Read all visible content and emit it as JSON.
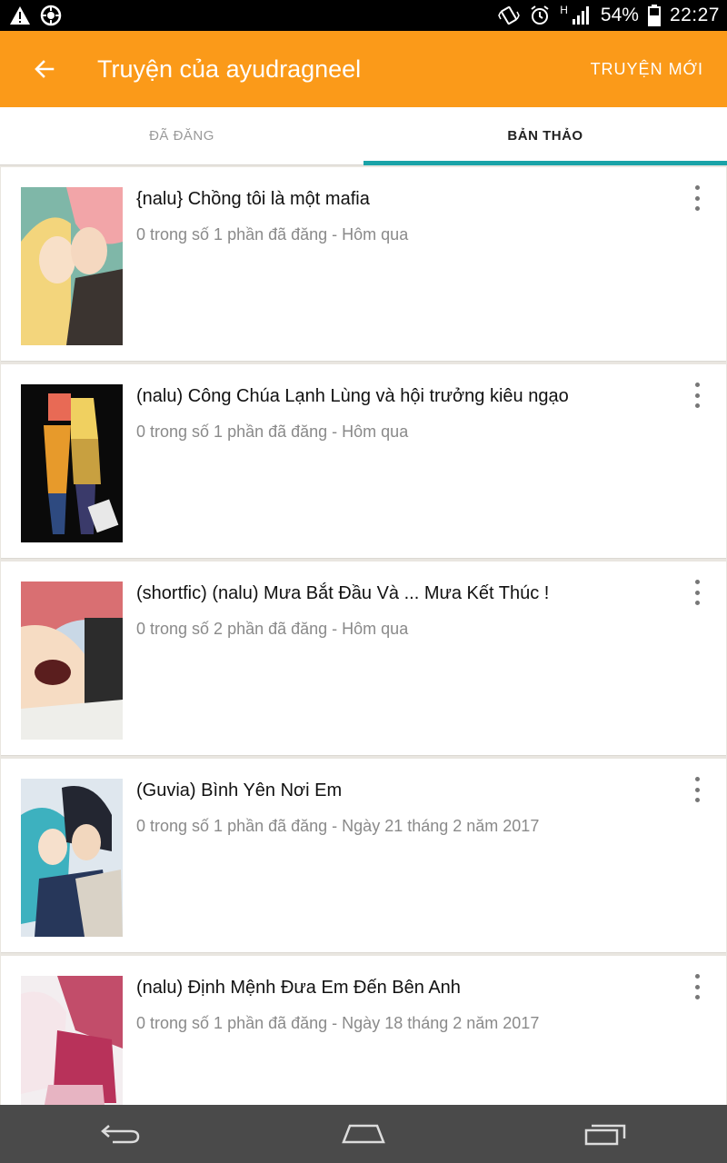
{
  "status_bar": {
    "left_icons": [
      "warning-icon",
      "sync-icon"
    ],
    "right_icons": [
      "vibrate-icon",
      "alarm-icon",
      "signal-icon",
      "battery-icon"
    ],
    "network_type": "H",
    "battery": "54%",
    "time": "22:27"
  },
  "app_bar": {
    "title": "Truyện của ayudragneel",
    "action": "TRUYỆN MỚI",
    "background": "#fb9a19"
  },
  "tabs": [
    {
      "label": "ĐÃ ĐĂNG",
      "active": false
    },
    {
      "label": "BẢN THẢO",
      "active": true
    }
  ],
  "accent": "#1aa3a8",
  "stories": [
    {
      "title": "{nalu} Chồng tôi là một mafia",
      "meta": "0 trong số 1 phần đã đăng - Hôm qua"
    },
    {
      "title": "(nalu) Công Chúa Lạnh Lùng và hội trưởng kiêu ngạo",
      "meta": "0 trong số 1 phần đã đăng - Hôm qua"
    },
    {
      "title": "(shortfic) (nalu) Mưa Bắt Đầu Và ... Mưa Kết Thúc !",
      "meta": "0 trong số 2 phần đã đăng - Hôm qua"
    },
    {
      "title": "(Guvia) Bình Yên Nơi Em",
      "meta": "0 trong số 1 phần đã đăng - Ngày 21 tháng 2 năm 2017"
    },
    {
      "title": "(nalu) Định Mệnh Đưa Em Đến Bên Anh",
      "meta": "0 trong số 1 phần đã đăng - Ngày 18 tháng 2 năm 2017"
    }
  ],
  "nav_bar": [
    "back-icon",
    "home-icon",
    "recents-icon"
  ]
}
